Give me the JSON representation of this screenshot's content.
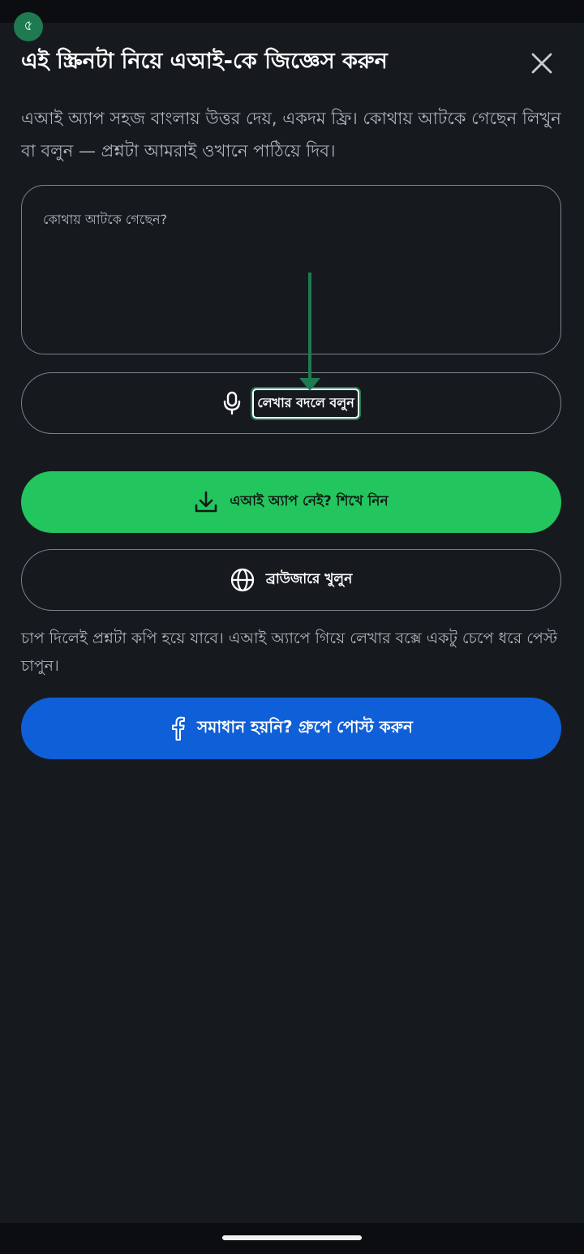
{
  "step_badge": "৫",
  "title": "এই স্ক্রিনটা নিয়ে এআই-কে জিজ্ঞেস করুন",
  "subtitle": "এআই অ্যাপ সহজ বাংলায় উত্তর দেয়, একদম ফ্রি। কোথায় আটকে গেছেন লিখুন বা বলুন — প্রশ্নটা আমরাই ওখানে পাঠিয়ে দিব।",
  "question": {
    "placeholder": "কোথায় আটকে গেছেন?",
    "value": ""
  },
  "voice_button": {
    "label": "লেখার বদলে বলুন",
    "icon": "microphone-icon"
  },
  "app_button": {
    "label": "এআই অ্যাপ নেই? শিখে নিন",
    "icon": "download-icon",
    "color": "#22c55e"
  },
  "browser_button": {
    "label": "ব্রাউজারে খুলুন",
    "icon": "globe-icon"
  },
  "note": "চাপ দিলেই প্রশ্নটা কপি হয়ে যাবে। এআই অ্যাপে গিয়ে লেখার বক্সে একটু চেপে ধরে পেস্ট চাপুন।",
  "group_button": {
    "label": "সমাধান হয়নি? গ্রুপে পোস্ট করুন",
    "icon": "facebook-icon",
    "color": "#0f5fd8"
  },
  "accent": "#1f7a52",
  "background": "#161a1f"
}
